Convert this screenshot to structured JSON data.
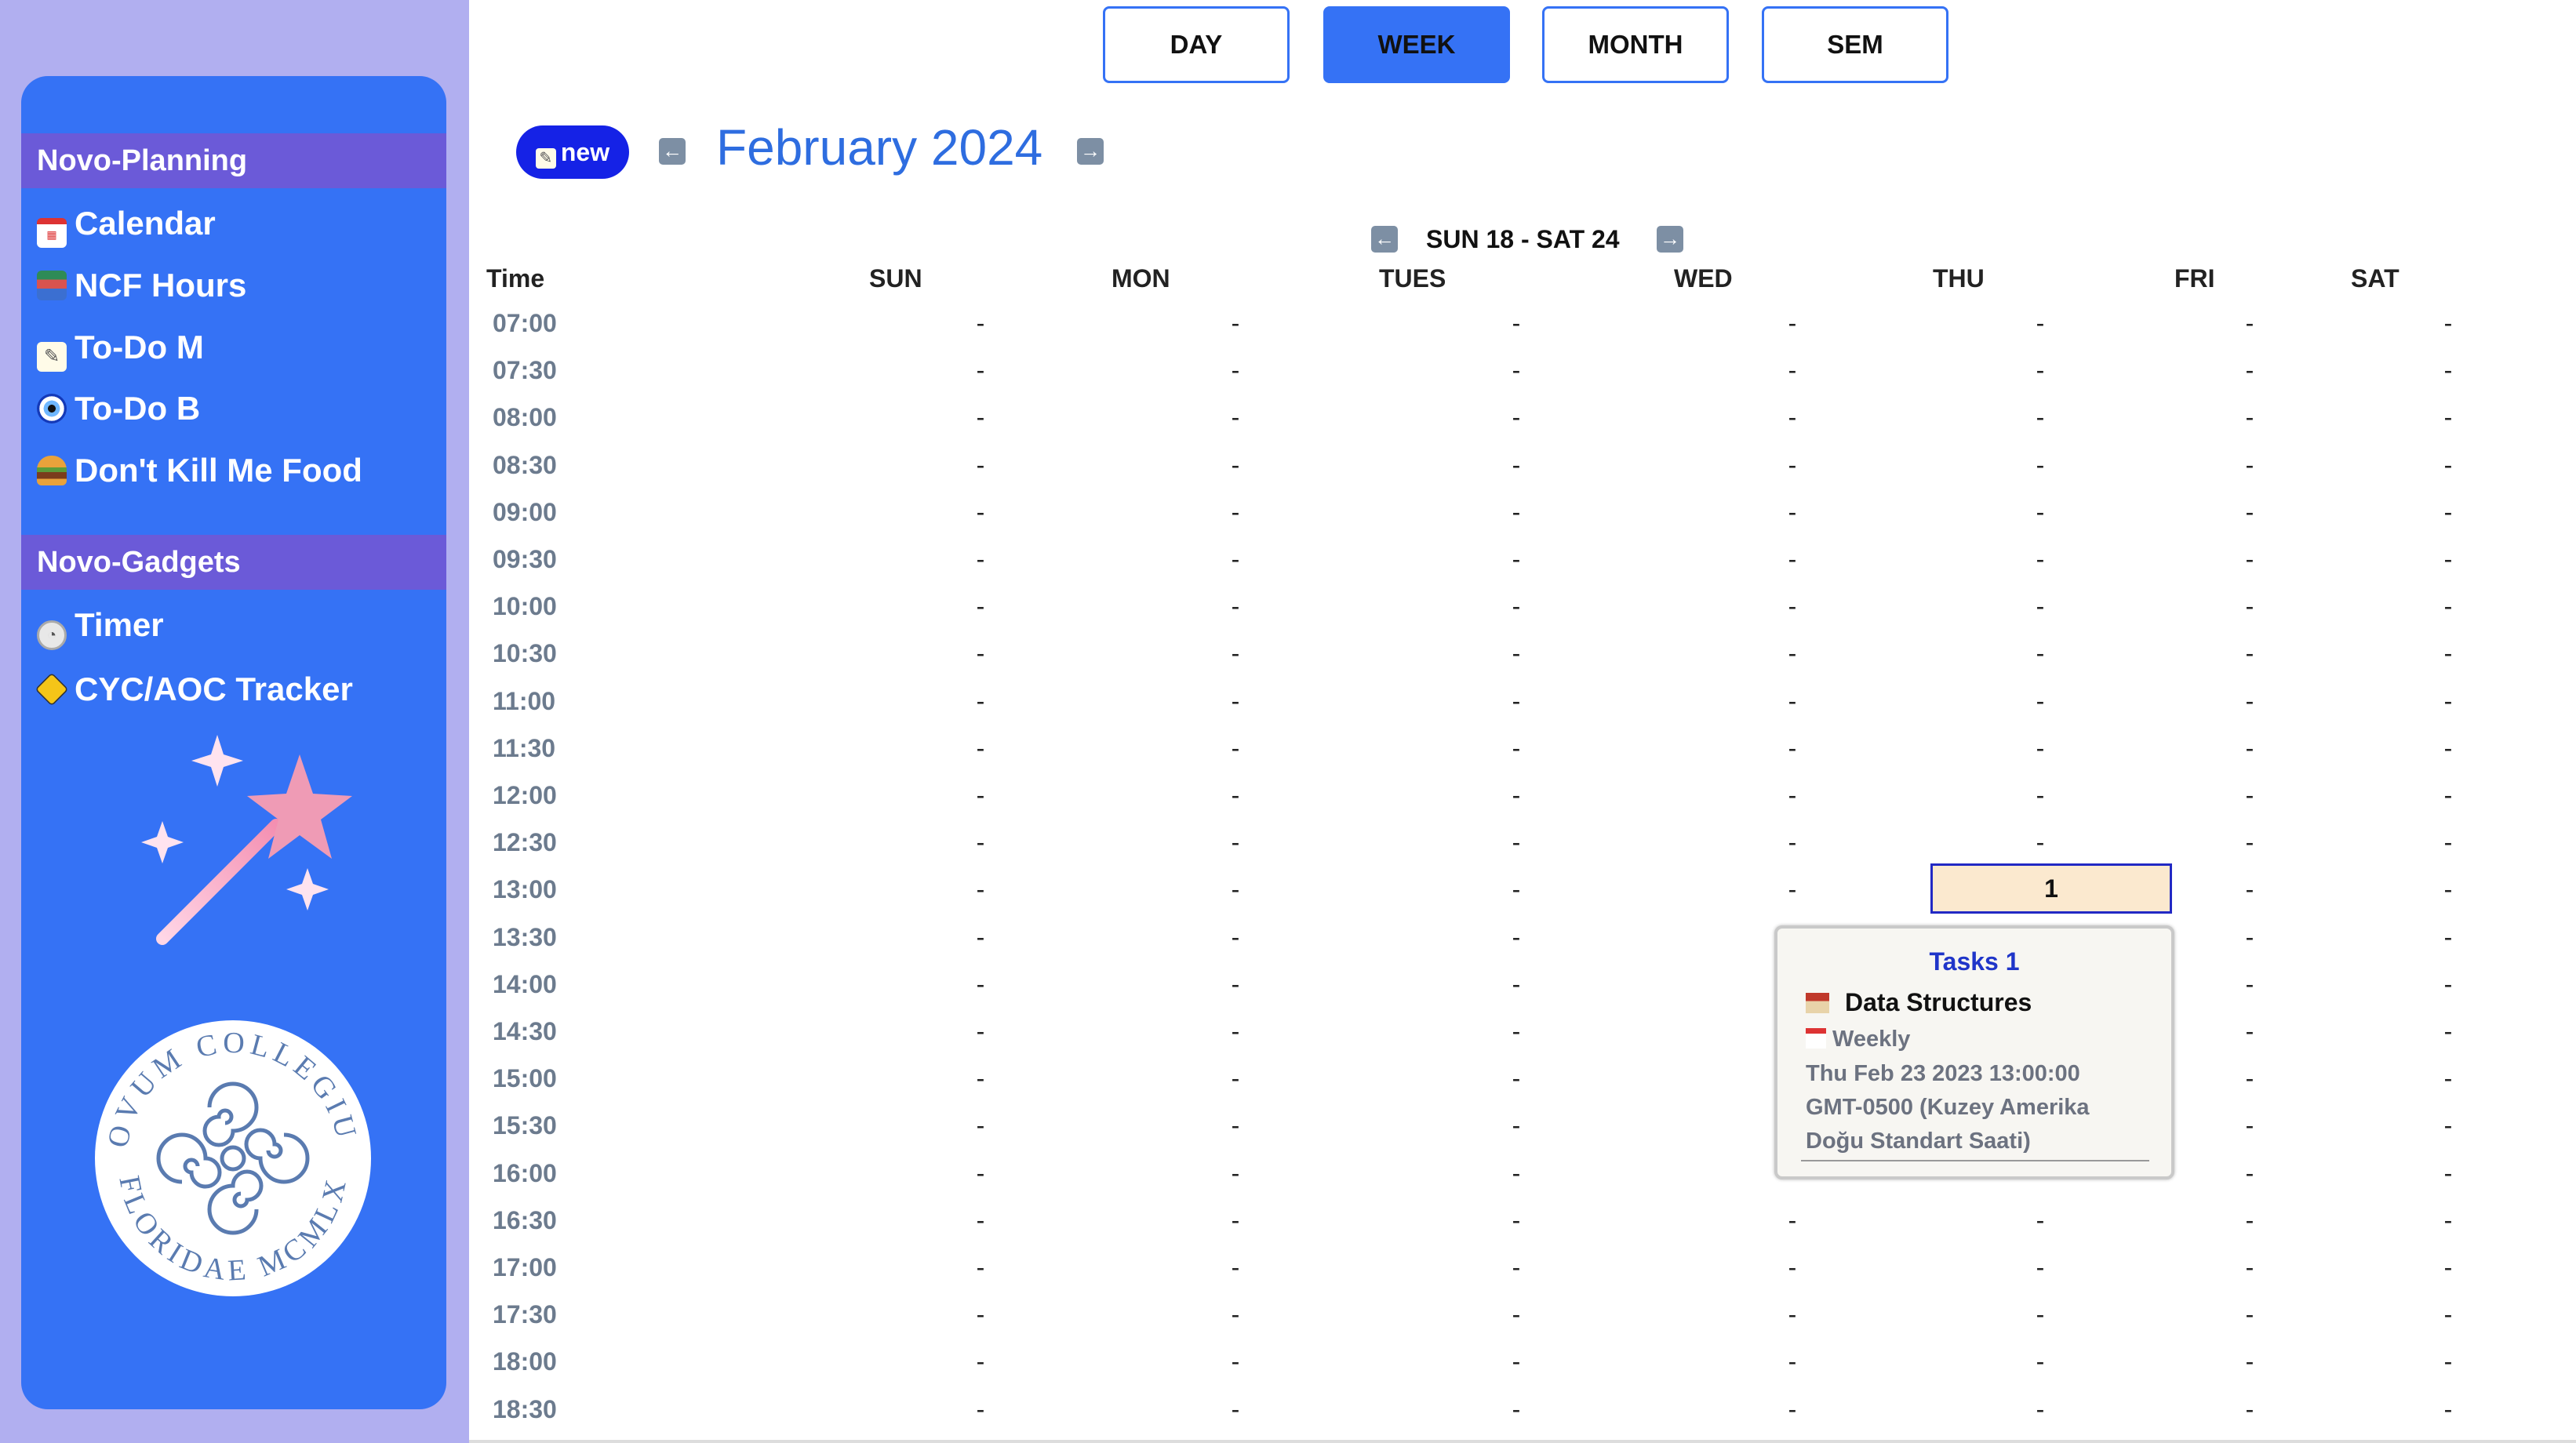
{
  "sidebar": {
    "sections": [
      {
        "title": "Novo-Planning",
        "items": [
          {
            "label": "Calendar",
            "icon": "calendar-icon"
          },
          {
            "label": "NCF Hours",
            "icon": "books-icon"
          },
          {
            "label": "To-Do M",
            "icon": "memo-icon"
          },
          {
            "label": "To-Do B",
            "icon": "nazar-icon"
          },
          {
            "label": "Don't Kill Me Food",
            "icon": "burger-icon"
          }
        ]
      },
      {
        "title": "Novo-Gadgets",
        "items": [
          {
            "label": "Timer",
            "icon": "clock-icon"
          },
          {
            "label": "CYC/AOC Tracker",
            "icon": "warning-sign-icon"
          }
        ]
      }
    ],
    "seal_text": "NOVUM COLLEGIUM FLORIDAE MCMLX"
  },
  "views": {
    "buttons": [
      "DAY",
      "WEEK",
      "MONTH",
      "SEM"
    ],
    "active": "WEEK"
  },
  "header": {
    "new_label": "new",
    "month_title": "February 2024",
    "week_range": "SUN 18 - SAT 24"
  },
  "grid": {
    "time_header": "Time",
    "days": [
      "SUN",
      "MON",
      "TUES",
      "WED",
      "THU",
      "FRI",
      "SAT"
    ],
    "times": [
      "07:00",
      "07:30",
      "08:00",
      "08:30",
      "09:00",
      "09:30",
      "10:00",
      "10:30",
      "11:00",
      "11:30",
      "12:00",
      "12:30",
      "13:00",
      "13:30",
      "14:00",
      "14:30",
      "15:00",
      "15:30",
      "16:00",
      "16:30",
      "17:00",
      "17:30",
      "18:00",
      "18:30"
    ],
    "empty_marker": "-"
  },
  "event": {
    "cell_value": "1",
    "day": "THU",
    "time": "13:00",
    "tooltip": {
      "title": "Tasks 1",
      "name": "Data Structures",
      "recurrence": "Weekly",
      "datetime_lines": [
        "Thu Feb 23 2023 13:00:00",
        "GMT-0500 (Kuzey Amerika",
        "Doğu Standart Saati)"
      ]
    }
  },
  "colors": {
    "accent": "#3572f5",
    "sidebar_bg": "#b1aff0",
    "section_header": "#6b5ad8",
    "title": "#2e6de0",
    "event_bg": "#fbe9cf"
  }
}
